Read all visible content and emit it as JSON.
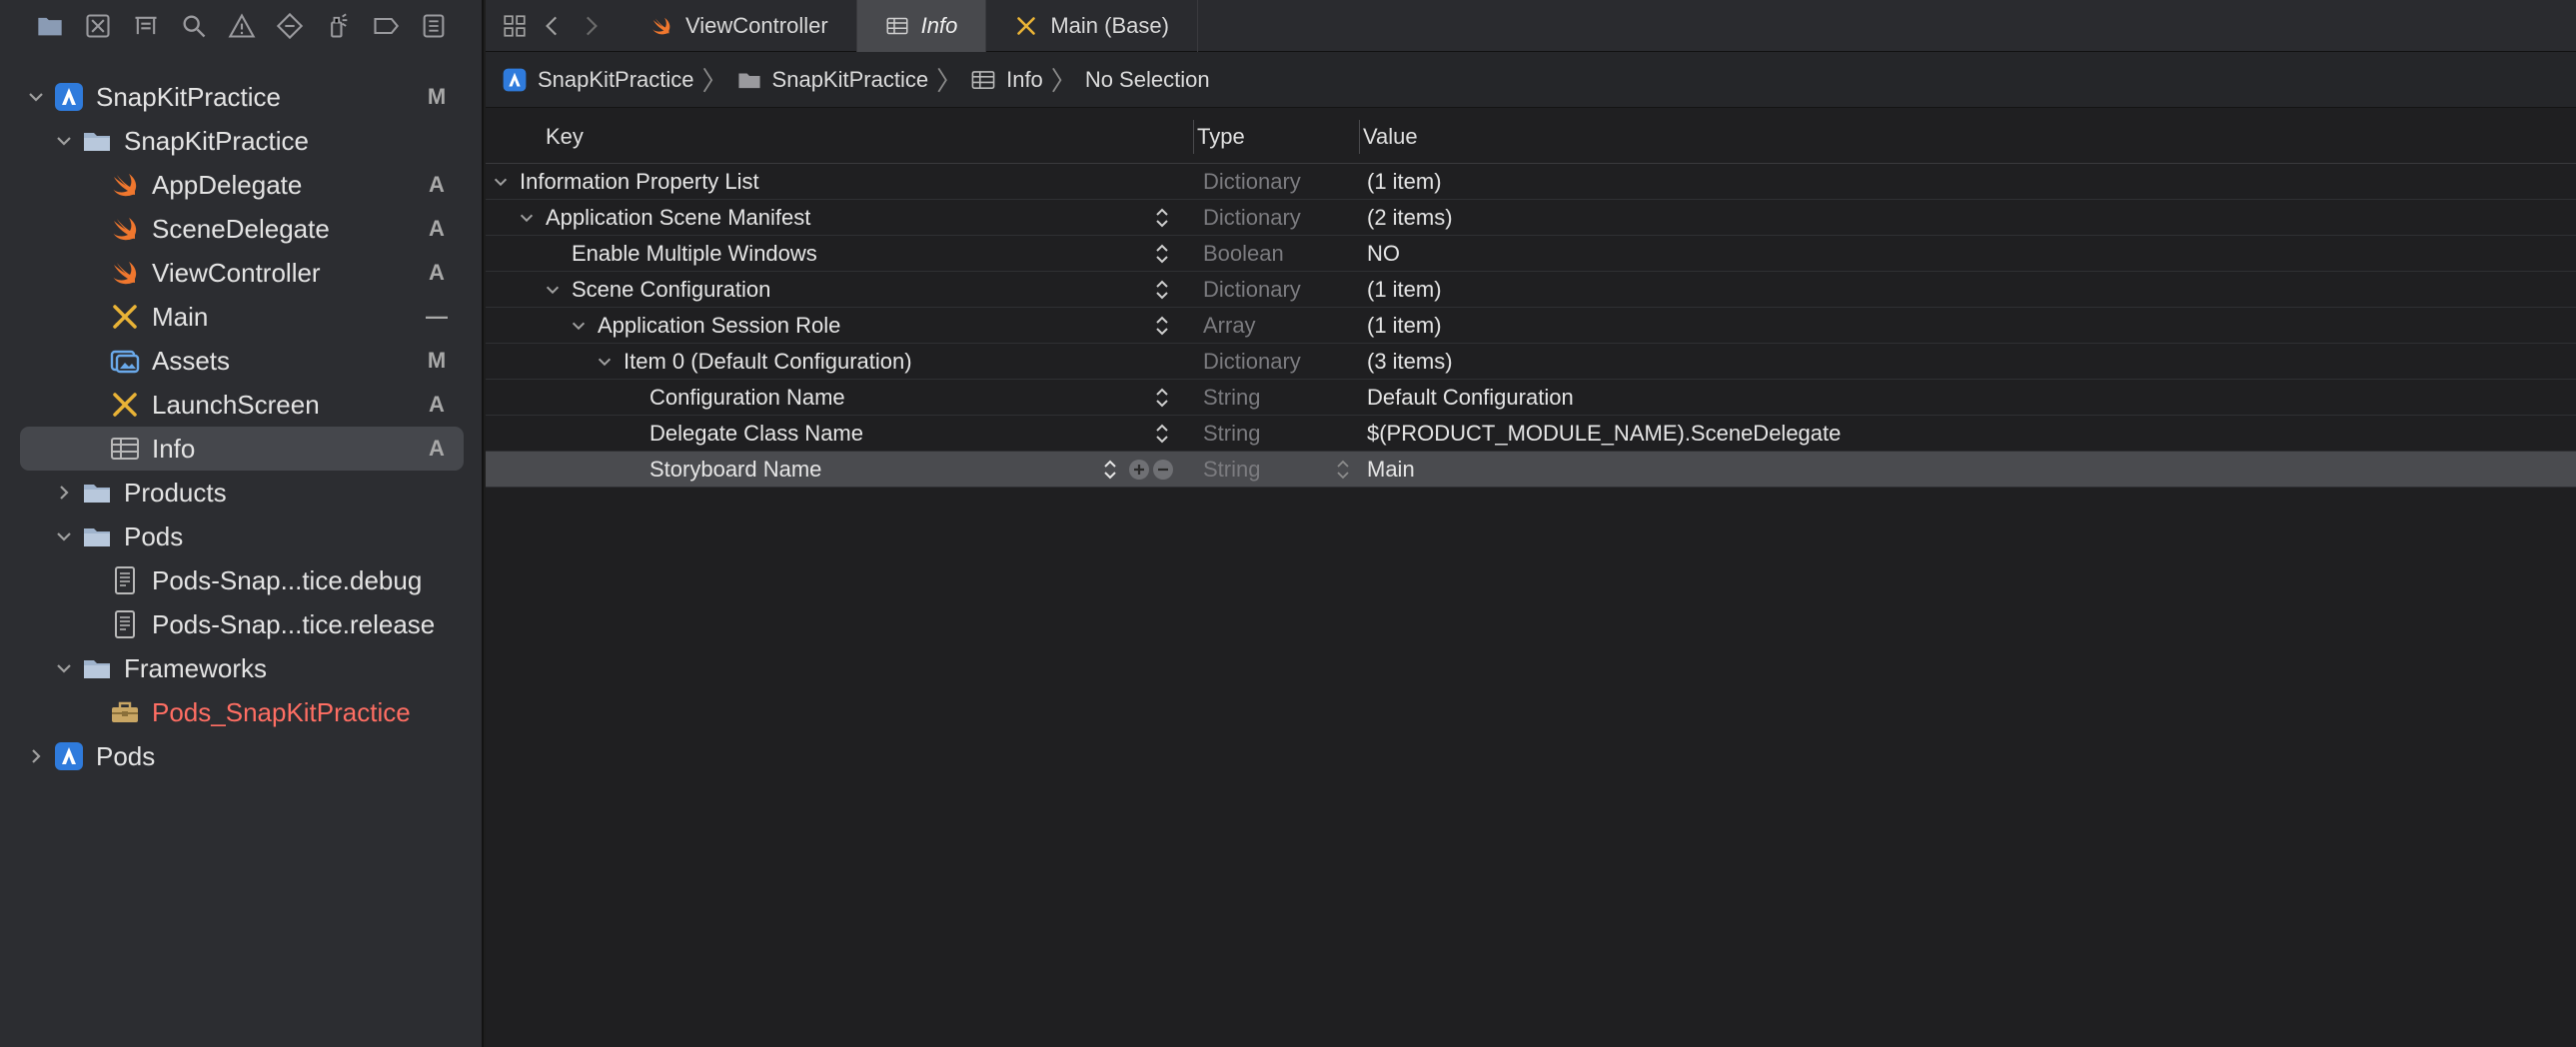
{
  "sidebar": {
    "tree": [
      {
        "label": "SnapKitPractice",
        "badge": "M"
      },
      {
        "label": "SnapKitPractice",
        "badge": ""
      },
      {
        "label": "AppDelegate",
        "badge": "A"
      },
      {
        "label": "SceneDelegate",
        "badge": "A"
      },
      {
        "label": "ViewController",
        "badge": "A"
      },
      {
        "label": "Main",
        "badge": "—"
      },
      {
        "label": "Assets",
        "badge": "M"
      },
      {
        "label": "LaunchScreen",
        "badge": "A"
      },
      {
        "label": "Info",
        "badge": "A"
      },
      {
        "label": "Products",
        "badge": ""
      },
      {
        "label": "Pods",
        "badge": ""
      },
      {
        "label": "Pods-Snap...tice.debug",
        "badge": ""
      },
      {
        "label": "Pods-Snap...tice.release",
        "badge": ""
      },
      {
        "label": "Frameworks",
        "badge": ""
      },
      {
        "label": "Pods_SnapKitPractice",
        "badge": ""
      },
      {
        "label": "Pods",
        "badge": ""
      }
    ]
  },
  "tabs": [
    {
      "label": "ViewController"
    },
    {
      "label": "Info"
    },
    {
      "label": "Main (Base)"
    }
  ],
  "breadcrumb": [
    "SnapKitPractice",
    "SnapKitPractice",
    "Info",
    "No Selection"
  ],
  "plist": {
    "headers": {
      "key": "Key",
      "type": "Type",
      "value": "Value"
    },
    "rows": [
      {
        "key": "Information Property List",
        "type": "Dictionary",
        "value": "(1 item)"
      },
      {
        "key": "Application Scene Manifest",
        "type": "Dictionary",
        "value": "(2 items)"
      },
      {
        "key": "Enable Multiple Windows",
        "type": "Boolean",
        "value": "NO"
      },
      {
        "key": "Scene Configuration",
        "type": "Dictionary",
        "value": "(1 item)"
      },
      {
        "key": "Application Session Role",
        "type": "Array",
        "value": "(1 item)"
      },
      {
        "key": "Item 0 (Default Configuration)",
        "type": "Dictionary",
        "value": "(3 items)"
      },
      {
        "key": "Configuration Name",
        "type": "String",
        "value": "Default Configuration"
      },
      {
        "key": "Delegate Class Name",
        "type": "String",
        "value": "$(PRODUCT_MODULE_NAME).SceneDelegate"
      },
      {
        "key": "Storyboard Name",
        "type": "String",
        "value": "Main"
      }
    ]
  },
  "colors": {
    "sidebar_bg": "#2c2d31",
    "editor_bg": "#1f1f21",
    "selection": "#45474c",
    "swift_orange": "#f0772e",
    "project_blue": "#2f7bdc",
    "framework_red": "#ff6e63",
    "ib_yellow": "#e9b336"
  }
}
